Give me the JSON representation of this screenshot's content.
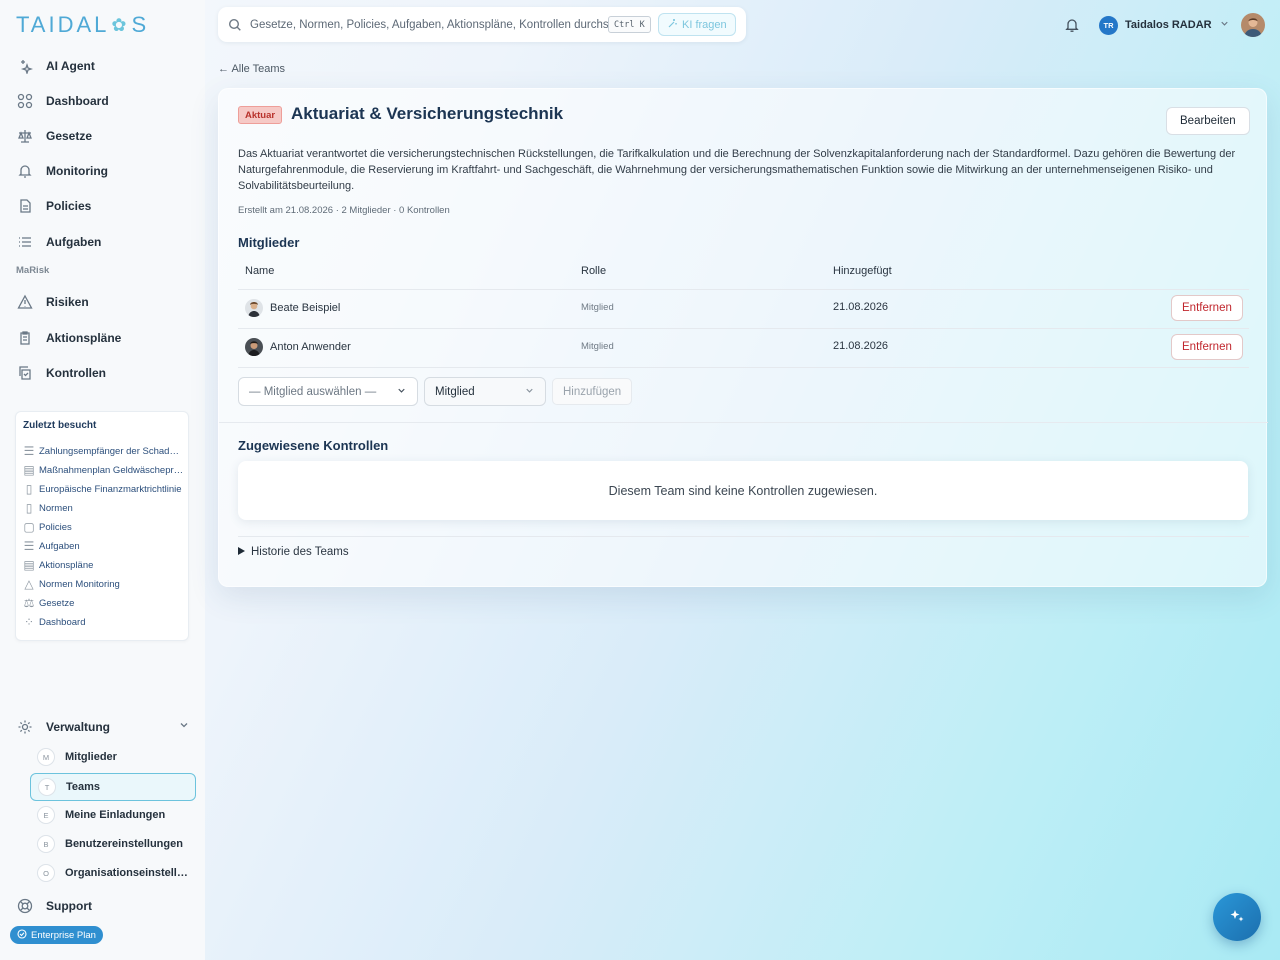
{
  "logo": {
    "text_left": "TAIDAL",
    "text_right": "S"
  },
  "nav": [
    {
      "label": "AI Agent",
      "icon": "sparkle-icon"
    },
    {
      "label": "Dashboard",
      "icon": "grid-icon"
    },
    {
      "label": "Gesetze",
      "icon": "scale-icon"
    },
    {
      "label": "Monitoring",
      "icon": "bell-icon"
    },
    {
      "label": "Policies",
      "icon": "document-icon"
    },
    {
      "label": "Aufgaben",
      "icon": "list-icon"
    }
  ],
  "section_marisk": "MaRisk",
  "nav_marisk": [
    {
      "label": "Risiken",
      "icon": "warning-icon"
    },
    {
      "label": "Aktionspläne",
      "icon": "clipboard-icon"
    },
    {
      "label": "Kontrollen",
      "icon": "copy-check-icon"
    }
  ],
  "recent": {
    "title": "Zuletzt besucht",
    "items": [
      "Zahlungsempfänger der Schadenregulierung",
      "Maßnahmenplan Geldwäscheprävention",
      "Europäische Finanzmarktrichtlinie",
      "Normen",
      "Policies",
      "Aufgaben",
      "Aktionspläne",
      "Normen Monitoring",
      "Gesetze",
      "Dashboard"
    ]
  },
  "admin": {
    "label": "Verwaltung",
    "items": [
      {
        "badge": "M",
        "label": "Mitglieder"
      },
      {
        "badge": "T",
        "label": "Teams"
      },
      {
        "badge": "E",
        "label": "Meine Einladungen"
      },
      {
        "badge": "B",
        "label": "Benutzereinstellungen"
      },
      {
        "badge": "O",
        "label": "Organisationseinstellungen"
      }
    ]
  },
  "support": "Support",
  "plan": "Enterprise Plan",
  "search": {
    "placeholder": "Gesetze, Normen, Policies, Aufgaben, Aktionspläne, Kontrollen durchs",
    "shortcut": "Ctrl K",
    "ask": "KI fragen"
  },
  "org": {
    "initials": "TR",
    "name": "Taidalos RADAR"
  },
  "back": "← Alle Teams",
  "team": {
    "tag": "Aktuar",
    "title": "Aktuariat & Versicherungstechnik",
    "edit": "Bearbeiten",
    "description": "Das Aktuariat verantwortet die versicherungstechnischen Rückstellungen, die Tarifkalkulation und die Berechnung der Solvenzkapitalanforderung nach der Standardformel. Dazu gehören die Bewertung der Naturgefahrenmodule, die Reservierung im Kraftfahrt- und Sachgeschäft, die Wahrnehmung der versicherungsmathematischen Funktion sowie die Mitwirkung an der unternehmenseigenen Risiko- und Solvabilitätsbeurteilung.",
    "meta": "Erstellt am 21.08.2026 · 2 Mitglieder · 0 Kontrollen"
  },
  "members": {
    "heading": "Mitglieder",
    "columns": [
      "Name",
      "Rolle",
      "Hinzugefügt"
    ],
    "rows": [
      {
        "name": "Beate Beispiel",
        "role": "Mitglied",
        "added": "21.08.2026",
        "action": "Entfernen"
      },
      {
        "name": "Anton Anwender",
        "role": "Mitglied",
        "added": "21.08.2026",
        "action": "Entfernen"
      }
    ],
    "select_member": "— Mitglied auswählen —",
    "select_role": "Mitglied",
    "add": "Hinzufügen"
  },
  "controls": {
    "heading": "Zugewiesene Kontrollen",
    "empty": "Diesem Team sind keine Kontrollen zugewiesen."
  },
  "history": "Historie des Teams",
  "colors": {
    "accent": "#2f8fd0",
    "danger": "#c0262d",
    "heading": "#1c3553"
  }
}
